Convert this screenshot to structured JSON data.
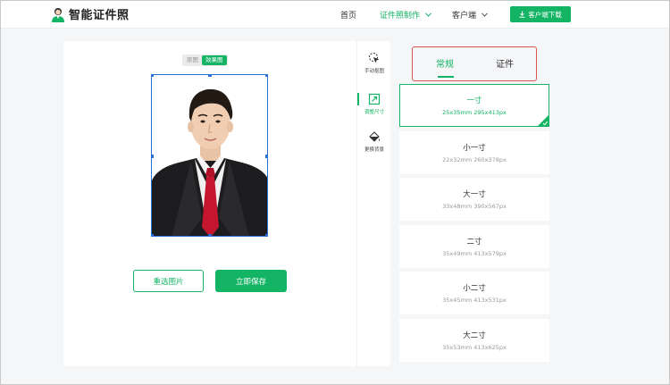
{
  "header": {
    "logo_text": "智能证件照",
    "nav": [
      {
        "label": "首页"
      },
      {
        "label": "证件照制作"
      },
      {
        "label": "客户端"
      }
    ],
    "download_label": "客户端下载"
  },
  "editor": {
    "view_tabs": [
      "原图",
      "效果图"
    ],
    "reselect_label": "重选图片",
    "save_label": "立即保存"
  },
  "tools": [
    {
      "label": "手动抠图",
      "icon": "cursor-icon"
    },
    {
      "label": "调整尺寸",
      "icon": "resize-icon"
    },
    {
      "label": "更换背景",
      "icon": "paint-bucket-icon"
    }
  ],
  "size_tabs": [
    "常规",
    "证件"
  ],
  "sizes": [
    {
      "name": "一寸",
      "dim": "25x35mm 295x413px"
    },
    {
      "name": "小一寸",
      "dim": "22x32mm 260x378px"
    },
    {
      "name": "大一寸",
      "dim": "33x48mm 390x567px"
    },
    {
      "name": "二寸",
      "dim": "35x49mm 413x579px"
    },
    {
      "name": "小二寸",
      "dim": "35x45mm 413x531px"
    },
    {
      "name": "大二寸",
      "dim": "35x53mm 413x625px"
    }
  ],
  "colors": {
    "accent": "#13b463",
    "highlight_box": "#d9534f",
    "selection_outline": "#2b6fd8"
  }
}
